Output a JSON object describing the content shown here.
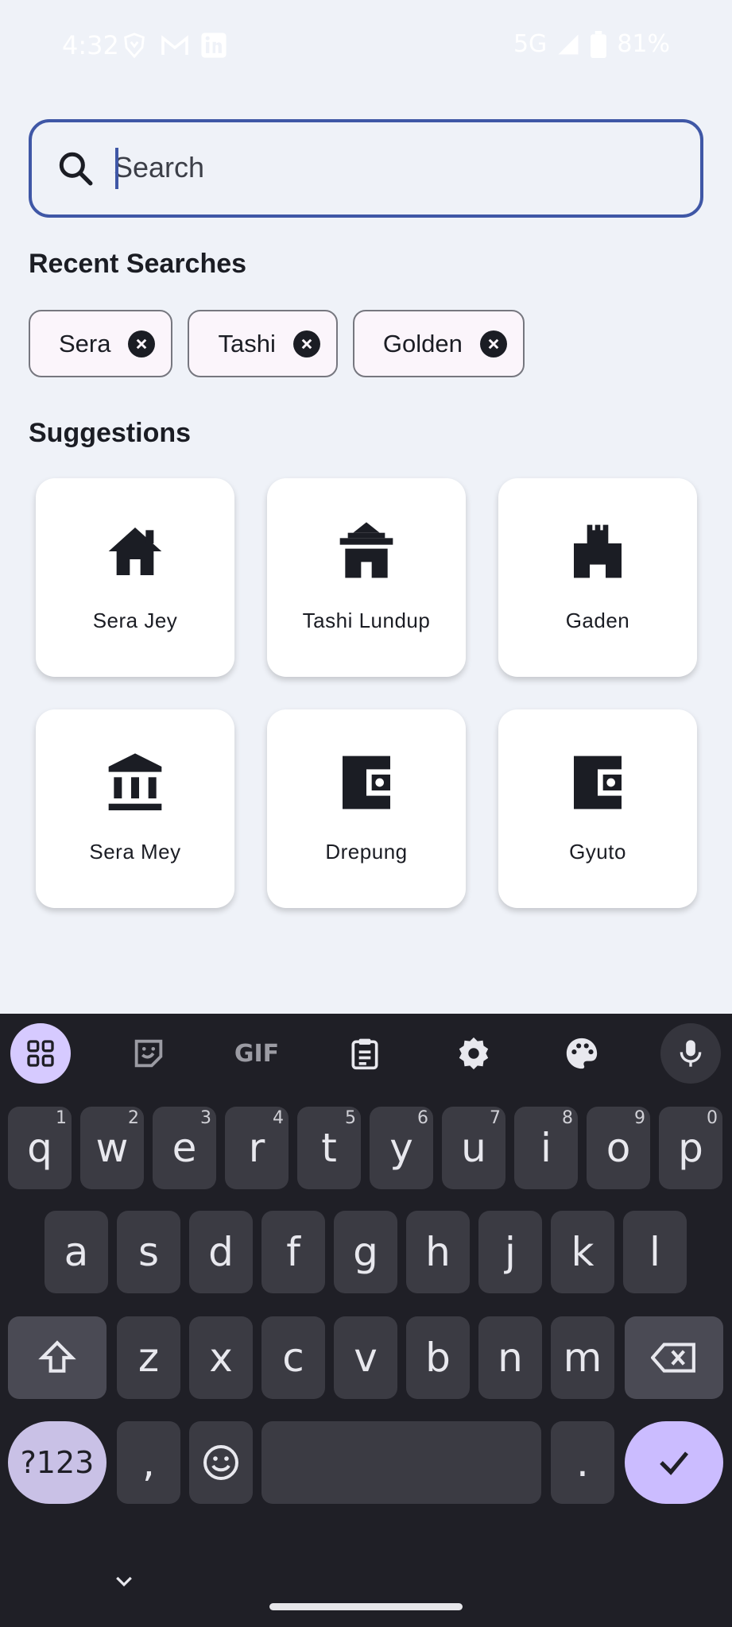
{
  "status_bar": {
    "time": "4:32",
    "network": "5G",
    "battery": "81%",
    "icons": [
      "brave-icon",
      "gmail-icon",
      "linkedin-icon",
      "signal-icon",
      "battery-icon"
    ]
  },
  "search": {
    "placeholder": "Search",
    "value": ""
  },
  "recent": {
    "title": "Recent Searches",
    "chips": [
      "Sera",
      "Tashi",
      "Golden"
    ]
  },
  "suggestions": {
    "title": "Suggestions",
    "items": [
      {
        "label": "Sera Jey",
        "icon": "house-icon"
      },
      {
        "label": "Tashi Lundup",
        "icon": "temple-icon"
      },
      {
        "label": "Gaden",
        "icon": "castle-icon"
      },
      {
        "label": "Sera Mey",
        "icon": "institution-icon"
      },
      {
        "label": "Drepung",
        "icon": "wallet-icon"
      },
      {
        "label": "Gyuto",
        "icon": "wallet-icon"
      }
    ]
  },
  "keyboard": {
    "toolbar": [
      "apps-icon",
      "sticker-icon",
      "GIF",
      "clipboard-icon",
      "settings-icon",
      "palette-icon",
      "mic-icon"
    ],
    "row1": [
      "q",
      "w",
      "e",
      "r",
      "t",
      "y",
      "u",
      "i",
      "o",
      "p"
    ],
    "row1_hints": [
      "1",
      "2",
      "3",
      "4",
      "5",
      "6",
      "7",
      "8",
      "9",
      "0"
    ],
    "row2": [
      "a",
      "s",
      "d",
      "f",
      "g",
      "h",
      "j",
      "k",
      "l"
    ],
    "row3": [
      "z",
      "x",
      "c",
      "v",
      "b",
      "n",
      "m"
    ],
    "symbols_label": "?123",
    "comma": ",",
    "period": ".",
    "gif_label": "GIF"
  },
  "colors": {
    "accent": "#3f57a6",
    "background": "#eff2f8",
    "keyboard_bg": "#1f1f26",
    "enter_key": "#cbbcff"
  }
}
